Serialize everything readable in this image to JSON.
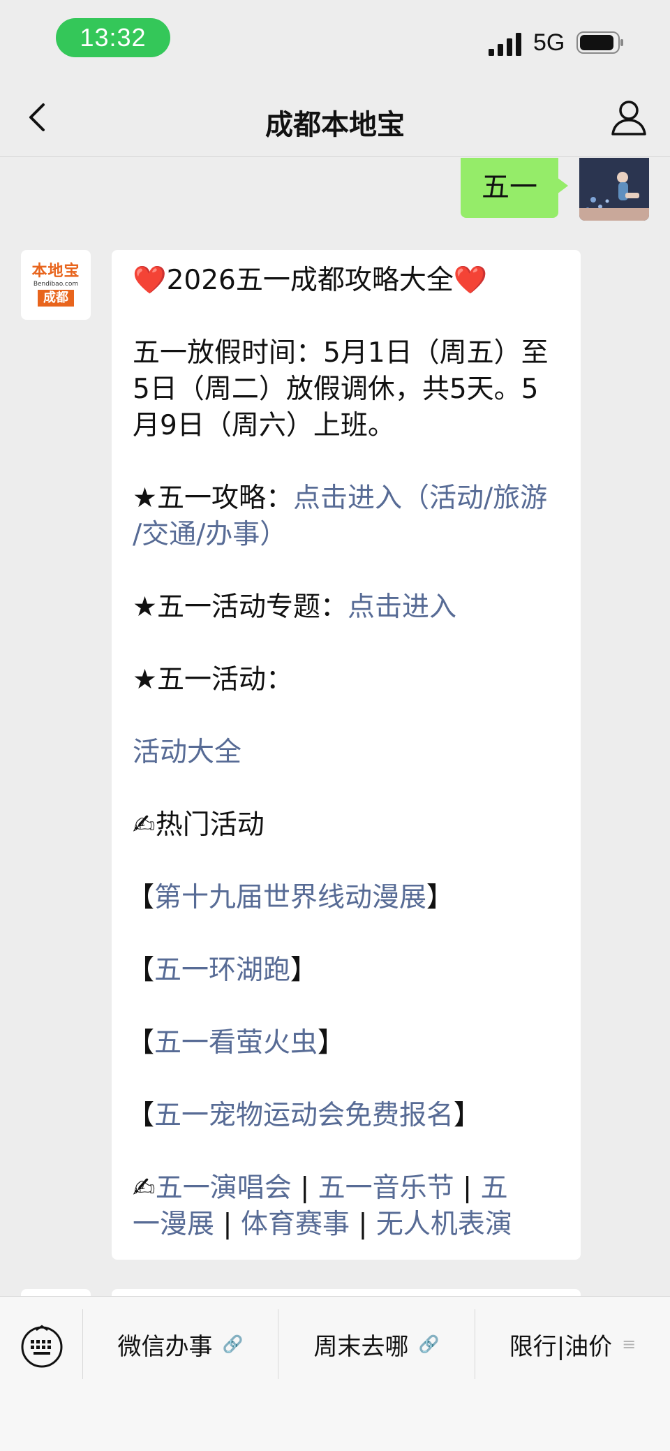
{
  "status_bar": {
    "time": "13:32",
    "network": "5G"
  },
  "nav": {
    "title": "成都本地宝"
  },
  "sent_message": {
    "text": "五一"
  },
  "bot_avatar": {
    "line1": "本地宝",
    "line2": "Bendibao.com",
    "line3": "成都"
  },
  "message": {
    "title_heart_left": "❤️",
    "title": "2026五一成都攻略大全",
    "title_heart_right": "❤️",
    "holiday_line1": "五一放假时间：5月1日（周五）至",
    "holiday_line2": "5日（周二）放假调休，共5天。5",
    "holiday_line3": "月9日（周六）上班。",
    "guide_label": "★五一攻略：",
    "guide_link_1": "点击进入（活动/旅游",
    "guide_link_2": "/交通/办事）",
    "topic_label": "★五一活动专题：",
    "topic_link": "点击进入",
    "activity_label": "★五一活动：",
    "activity_all": "活动大全",
    "hot_icon": "✍",
    "hot_label": "热门活动",
    "bracket_open": "【",
    "bracket_close": "】",
    "event_1": "第十九届世界线动漫展",
    "event_2": "五一环湖跑",
    "event_3": "五一看萤火虫",
    "event_4": "五一宠物运动会免费报名",
    "more_icon": "✍",
    "more_1": "五一演唱会",
    "sep": " | ",
    "more_2": "五一音乐节",
    "more_3a": "五",
    "more_3b": "一漫展",
    "more_4": "体育赛事",
    "more_5": "无人机表演"
  },
  "bottom_menu": {
    "item1": "微信办事",
    "item2": "周末去哪",
    "item3": "限行|油价",
    "icon1": "link-icon",
    "icon2": "link-icon",
    "icon3": "menu-icon"
  }
}
